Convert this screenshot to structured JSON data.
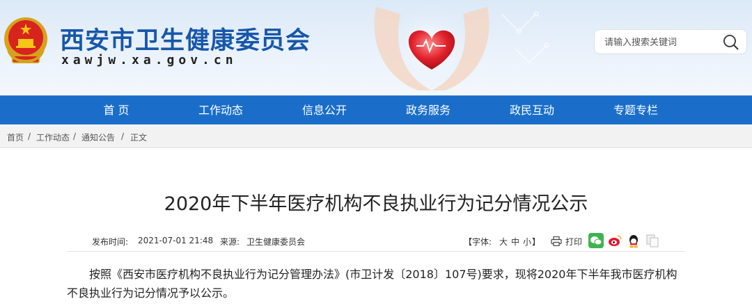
{
  "site": {
    "title": "西安市卫生健康委员会",
    "url": "xawjw.xa.gov.cn"
  },
  "search": {
    "placeholder": "请输入搜索关键词"
  },
  "nav": [
    "首 页",
    "工作动态",
    "信息公开",
    "政务服务",
    "政民互动",
    "专题专栏"
  ],
  "breadcrumb": {
    "items": [
      "首页",
      "工作动态",
      "通知公告",
      "正文"
    ],
    "separator": "/"
  },
  "article": {
    "title": "2020年下半年医疗机构不良执业行为记分情况公示",
    "publish_label": "发布时间:",
    "publish_time": "2021-07-01 21:48",
    "source_label": "来源:",
    "source": "卫生健康委员会",
    "font_label": "【字体:",
    "font_sizes": [
      "大",
      "中",
      "小"
    ],
    "font_close": "】",
    "print_label": "打印",
    "body": "按照《西安市医疗机构不良执业行为记分管理办法》(市卫计发〔2018〕107号)要求，现将2020年下半年我市医疗机构不良执业行为记分情况予以公示。"
  },
  "share_icons": [
    "wechat-icon",
    "weibo-icon",
    "qq-icon",
    "copy-icon"
  ],
  "colors": {
    "brand_blue": "#1757a9",
    "nav_blue": "#1a6ec9",
    "breadcrumb_bg": "#f2f2f2"
  }
}
